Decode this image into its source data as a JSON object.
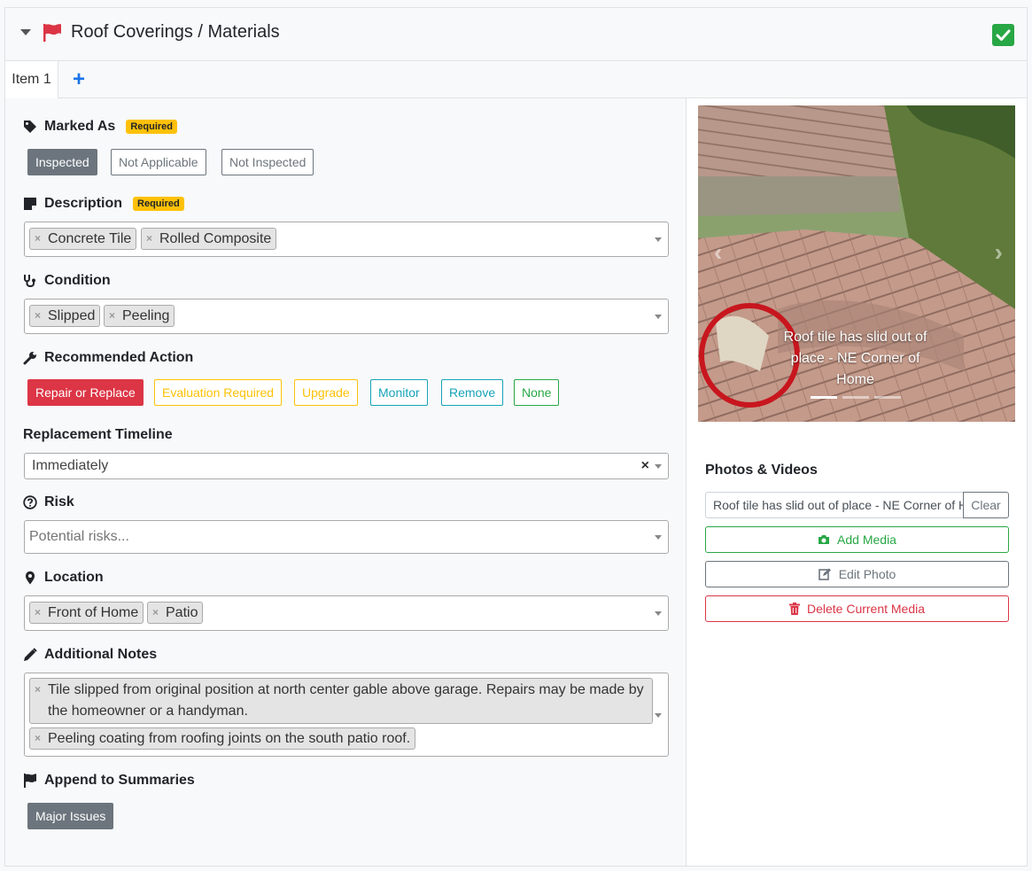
{
  "header": {
    "title": "Roof Coverings / Materials",
    "flag_color": "#dc3545",
    "check_color": "#28a745"
  },
  "tabs": {
    "items": [
      {
        "label": "Item 1"
      }
    ],
    "add_label": "+"
  },
  "marked_as": {
    "label": "Marked As",
    "required_badge": "Required",
    "options": [
      "Inspected",
      "Not Applicable",
      "Not Inspected"
    ],
    "selected": "Inspected"
  },
  "description": {
    "label": "Description",
    "required_badge": "Required",
    "tags": [
      "Concrete Tile",
      "Rolled Composite"
    ]
  },
  "condition": {
    "label": "Condition",
    "tags": [
      "Slipped",
      "Peeling"
    ]
  },
  "recommended_action": {
    "label": "Recommended Action",
    "options": [
      "Repair or Replace",
      "Evaluation Required",
      "Upgrade",
      "Monitor",
      "Remove",
      "None"
    ],
    "selected": "Repair or Replace"
  },
  "replacement_timeline": {
    "label": "Replacement Timeline",
    "value": "Immediately",
    "clear": "×"
  },
  "risk": {
    "label": "Risk",
    "placeholder": "Potential risks..."
  },
  "location": {
    "label": "Location",
    "tags": [
      "Front of Home",
      "Patio"
    ]
  },
  "additional_notes": {
    "label": "Additional Notes",
    "tags": [
      "Tile slipped from original position at north center gable above garage. Repairs may be made by the homeowner or a handyman.",
      "Peeling coating from roofing joints on the south patio roof."
    ]
  },
  "append_to_summaries": {
    "label": "Append to Summaries",
    "options": [
      "Major Issues"
    ]
  },
  "media": {
    "caption": "Roof tile has slid out of place - NE Corner of Home",
    "slide_count": 3,
    "active_slide": 1,
    "section_title": "Photos & Videos",
    "caption_input_value": "Roof tile has slid out of place - NE Corner of Home",
    "clear_label": "Clear",
    "add_label": "Add Media",
    "edit_label": "Edit Photo",
    "delete_label": "Delete Current Media"
  }
}
